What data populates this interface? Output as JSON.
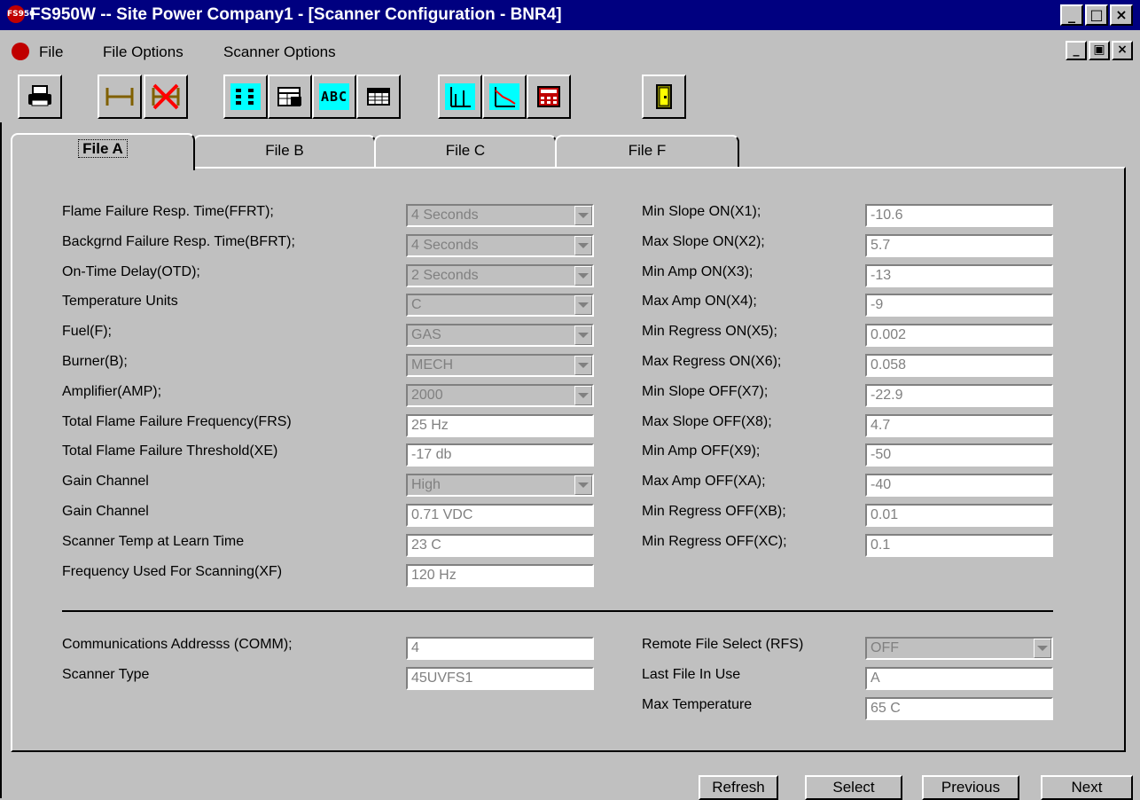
{
  "titlebar": {
    "app_icon_text": "FS950",
    "title": "FS950W -- Site Power Company1 - [Scanner Configuration - BNR4]"
  },
  "menu": {
    "items": [
      "File",
      "File Options",
      "Scanner Options"
    ]
  },
  "toolbar": {
    "buttons": [
      "printer-icon",
      "span-icon",
      "span-x-icon",
      "list-icon",
      "table-edit-icon",
      "abc-icon",
      "grid-icon",
      "bar-chart-icon",
      "trend-chart-icon",
      "calculator-icon",
      "exit-door-icon"
    ]
  },
  "tabs": [
    "File A",
    "File B",
    "File C",
    "File F"
  ],
  "left_fields": [
    {
      "label": "Flame Failure Resp. Time(FFRT);",
      "value": "4 Seconds",
      "type": "combo"
    },
    {
      "label": "Backgrnd Failure Resp. Time(BFRT);",
      "value": "4 Seconds",
      "type": "combo"
    },
    {
      "label": "On-Time Delay(OTD);",
      "value": "2 Seconds",
      "type": "combo"
    },
    {
      "label": "Temperature Units",
      "value": "C",
      "type": "combo"
    },
    {
      "label": "Fuel(F);",
      "value": "GAS",
      "type": "combo"
    },
    {
      "label": "Burner(B);",
      "value": "MECH",
      "type": "combo"
    },
    {
      "label": "Amplifier(AMP);",
      "value": "2000",
      "type": "combo"
    },
    {
      "label": "Total Flame Failure Frequency(FRS)",
      "value": "25 Hz",
      "type": "text"
    },
    {
      "label": "Total Flame Failure Threshold(XE)",
      "value": "-17 db",
      "type": "text"
    },
    {
      "label": "Gain Channel",
      "value": "High",
      "type": "combo"
    },
    {
      "label": "Gain Channel",
      "value": "0.71 VDC",
      "type": "text"
    },
    {
      "label": "Scanner Temp at Learn Time",
      "value": "23 C",
      "type": "text"
    },
    {
      "label": "Frequency Used For Scanning(XF)",
      "value": "120 Hz",
      "type": "text"
    }
  ],
  "right_fields": [
    {
      "label": "Min Slope ON(X1);",
      "value": "-10.6"
    },
    {
      "label": "Max Slope ON(X2);",
      "value": "5.7"
    },
    {
      "label": "Min Amp ON(X3);",
      "value": "-13"
    },
    {
      "label": "Max Amp ON(X4);",
      "value": "-9"
    },
    {
      "label": "Min Regress ON(X5);",
      "value": "0.002"
    },
    {
      "label": "Max Regress ON(X6);",
      "value": "0.058"
    },
    {
      "label": "Min Slope OFF(X7);",
      "value": "-22.9"
    },
    {
      "label": "Max Slope OFF(X8);",
      "value": "4.7"
    },
    {
      "label": "Min Amp OFF(X9);",
      "value": "-50"
    },
    {
      "label": "Max Amp OFF(XA);",
      "value": "-40"
    },
    {
      "label": "Min Regress OFF(XB);",
      "value": "0.01"
    },
    {
      "label": "Min Regress OFF(XC);",
      "value": "0.1"
    }
  ],
  "bottom_left": [
    {
      "label": "Communications Addresss (COMM);",
      "value": "4"
    },
    {
      "label": "Scanner Type",
      "value": "45UVFS1"
    }
  ],
  "bottom_right": [
    {
      "label": "Remote File Select (RFS)",
      "value": "OFF",
      "type": "combo"
    },
    {
      "label": "Last File In Use",
      "value": "A",
      "type": "text"
    },
    {
      "label": "Max Temperature",
      "value": "65 C",
      "type": "text"
    }
  ],
  "buttons": {
    "refresh": "Refresh",
    "select": "Select",
    "previous": "Previous",
    "next": "Next"
  },
  "window_buttons": {
    "minimize": "_",
    "maximize": "□",
    "restore": "▣",
    "close": "×"
  }
}
